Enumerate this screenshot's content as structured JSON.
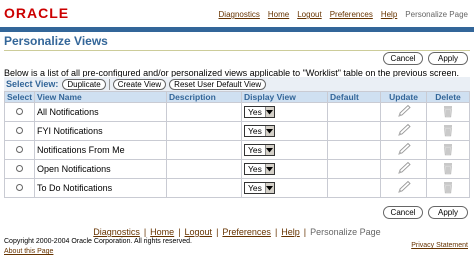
{
  "brand": {
    "logo_text": "ORACLE"
  },
  "global_links": {
    "diagnostics": "Diagnostics",
    "home": "Home",
    "logout": "Logout",
    "preferences": "Preferences",
    "help": "Help",
    "current": "Personalize Page"
  },
  "page": {
    "title": "Personalize Views"
  },
  "actions": {
    "cancel": "Cancel",
    "apply": "Apply"
  },
  "instructions": "Below is a list of all pre-configured and/or personalized views applicable to \"Worklist\" table on the previous screen.",
  "select_bar": {
    "label": "Select View:",
    "duplicate": "Duplicate",
    "create_view": "Create View",
    "reset_default": "Reset User Default View"
  },
  "table": {
    "headers": {
      "select": "Select",
      "view_name": "View Name",
      "description": "Description",
      "display_view": "Display View",
      "default": "Default",
      "update": "Update",
      "delete": "Delete"
    },
    "rows": [
      {
        "view_name": "All Notifications",
        "description": "",
        "display_view": "Yes",
        "default": ""
      },
      {
        "view_name": "FYI Notifications",
        "description": "",
        "display_view": "Yes",
        "default": ""
      },
      {
        "view_name": "Notifications From Me",
        "description": "",
        "display_view": "Yes",
        "default": ""
      },
      {
        "view_name": "Open Notifications",
        "description": "",
        "display_view": "Yes",
        "default": ""
      },
      {
        "view_name": "To Do Notifications",
        "description": "",
        "display_view": "Yes",
        "default": ""
      }
    ]
  },
  "footer": {
    "diagnostics": "Diagnostics",
    "home": "Home",
    "logout": "Logout",
    "preferences": "Preferences",
    "help": "Help",
    "current": "Personalize Page",
    "copyright": "Copyright 2000-2004 Oracle Corporation. All rights reserved.",
    "about": "About this Page",
    "privacy": "Privacy Statement"
  },
  "colors": {
    "brand_red": "#cc0000",
    "header_blue": "#336699",
    "table_header_bg": "#cfe0f1",
    "link_brown": "#663300"
  }
}
